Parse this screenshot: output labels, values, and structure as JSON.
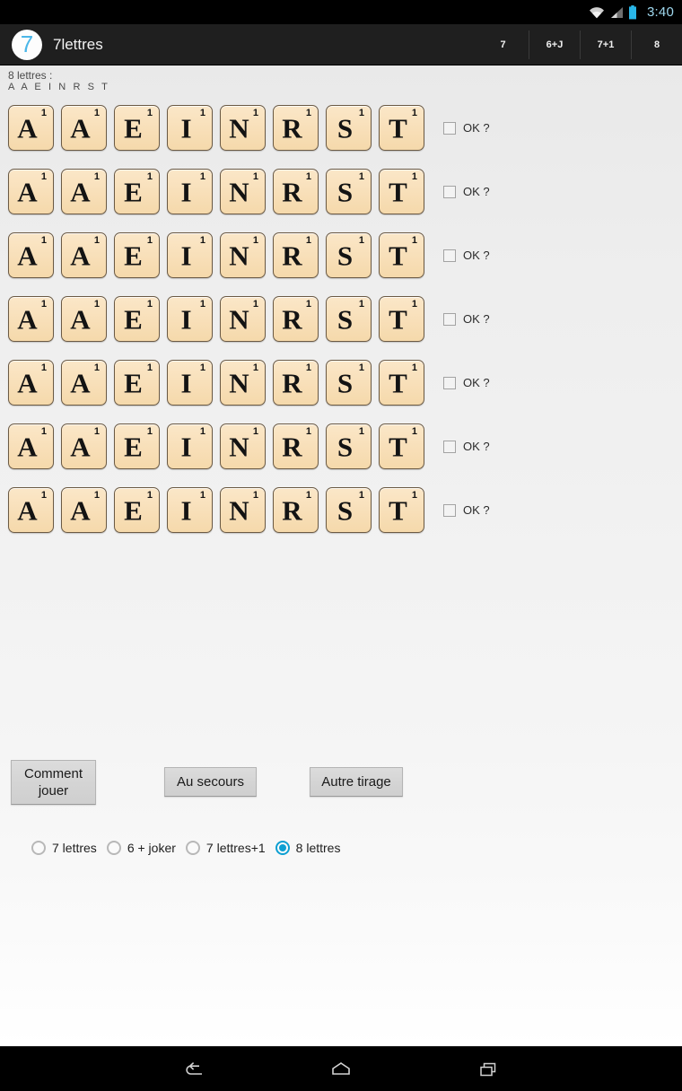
{
  "status_bar": {
    "time": "3:40",
    "icons": [
      "wifi-icon",
      "cell-signal-icon",
      "battery-icon"
    ],
    "accent_color": "#9fd8ee"
  },
  "action_bar": {
    "logo_text": "7",
    "logo_color": "#4ab6e8",
    "title": "7lettres",
    "tabs": [
      {
        "label": "7",
        "selected": false
      },
      {
        "label": "6+J",
        "selected": false
      },
      {
        "label": "7+1",
        "selected": false
      },
      {
        "label": "8",
        "selected": false
      }
    ]
  },
  "tirage": {
    "label": "8 lettres :",
    "letters_line": "A A E I N R S T",
    "tiles": [
      {
        "letter": "A",
        "value": "1"
      },
      {
        "letter": "A",
        "value": "1"
      },
      {
        "letter": "E",
        "value": "1"
      },
      {
        "letter": "I",
        "value": "1"
      },
      {
        "letter": "N",
        "value": "1"
      },
      {
        "letter": "R",
        "value": "1"
      },
      {
        "letter": "S",
        "value": "1"
      },
      {
        "letter": "T",
        "value": "1"
      }
    ],
    "row_count": 7,
    "ok_label": "OK ?",
    "ok_checked": false,
    "tile_face_color": "#f8dfb8",
    "tile_border_color": "#6b5a44"
  },
  "buttons": {
    "how_to_play": "Comment jouer",
    "help": "Au secours",
    "new_draw": "Autre tirage"
  },
  "modes": {
    "options": [
      {
        "label": "7 lettres",
        "selected": false
      },
      {
        "label": "6 + joker",
        "selected": false
      },
      {
        "label": "7 lettres+1",
        "selected": false
      },
      {
        "label": "8 lettres",
        "selected": true
      }
    ],
    "selected_color": "#0c9fd2"
  },
  "nav_bar": {
    "buttons": [
      "back-icon",
      "home-icon",
      "recents-icon"
    ]
  }
}
